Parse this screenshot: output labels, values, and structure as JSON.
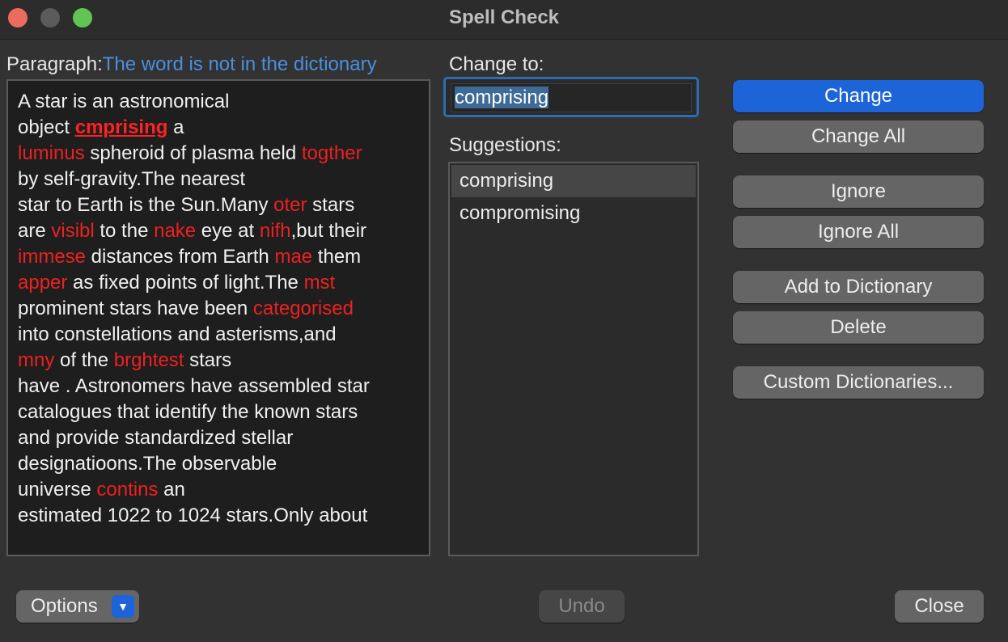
{
  "window": {
    "title": "Spell Check"
  },
  "paragraph": {
    "label": "Paragraph:",
    "status": "The word is not in the dictionary",
    "lines": [
      [
        {
          "t": "A star is an astronomical"
        }
      ],
      [
        {
          "t": "object "
        },
        {
          "t": "cmprising",
          "s": "cur"
        },
        {
          "t": " a"
        }
      ],
      [
        {
          "t": "luminus",
          "s": "err"
        },
        {
          "t": " spheroid of plasma held "
        },
        {
          "t": "togther",
          "s": "err"
        }
      ],
      [
        {
          "t": "by self-gravity.The nearest"
        }
      ],
      [
        {
          "t": "star to Earth is the Sun.Many "
        },
        {
          "t": "oter",
          "s": "err"
        },
        {
          "t": " stars"
        }
      ],
      [
        {
          "t": "are "
        },
        {
          "t": "visibl",
          "s": "err"
        },
        {
          "t": " to the "
        },
        {
          "t": "nake",
          "s": "err"
        },
        {
          "t": " eye at "
        },
        {
          "t": "nifh",
          "s": "err"
        },
        {
          "t": ",but their"
        }
      ],
      [
        {
          "t": "immese",
          "s": "err"
        },
        {
          "t": " distances from Earth "
        },
        {
          "t": "mae",
          "s": "err"
        },
        {
          "t": " them"
        }
      ],
      [
        {
          "t": "apper",
          "s": "err"
        },
        {
          "t": " as fixed points of light.The "
        },
        {
          "t": "mst",
          "s": "err"
        }
      ],
      [
        {
          "t": "prominent stars have been "
        },
        {
          "t": "categorised",
          "s": "err"
        }
      ],
      [
        {
          "t": "into constellations and asterisms,and"
        }
      ],
      [
        {
          "t": "mny",
          "s": "err"
        },
        {
          "t": " of the "
        },
        {
          "t": "brghtest",
          "s": "err"
        },
        {
          "t": " stars"
        }
      ],
      [
        {
          "t": "have . Astronomers have assembled star"
        }
      ],
      [
        {
          "t": "catalogues that identify the known stars"
        }
      ],
      [
        {
          "t": "and provide standardized stellar"
        }
      ],
      [
        {
          "t": "designatioons.The observable"
        }
      ],
      [
        {
          "t": "universe "
        },
        {
          "t": "contins",
          "s": "err"
        },
        {
          "t": " an"
        }
      ],
      [
        {
          "t": "estimated 1022 to 1024 stars.Only about"
        }
      ]
    ]
  },
  "change_to": {
    "label": "Change to:",
    "value": "comprising"
  },
  "suggestions": {
    "label": "Suggestions:",
    "items": [
      "comprising",
      "compromising"
    ],
    "selected_index": 0
  },
  "buttons": {
    "change": "Change",
    "change_all": "Change All",
    "ignore": "Ignore",
    "ignore_all": "Ignore All",
    "add_to_dictionary": "Add to Dictionary",
    "delete": "Delete",
    "custom_dictionaries": "Custom Dictionaries...",
    "options": "Options",
    "undo": "Undo",
    "close": "Close"
  },
  "colors": {
    "misspelled": "#ee2020",
    "accent": "#1c64d8",
    "status_text": "#4a8fe0"
  }
}
